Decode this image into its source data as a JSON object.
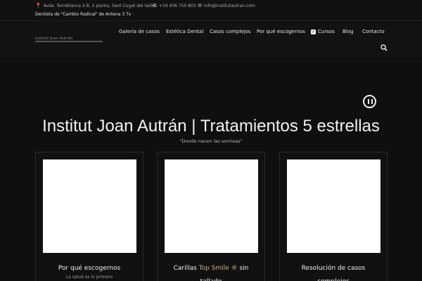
{
  "topbar": {
    "address": "Avda. Torreblanca 2-8, 2 planta, Sant Cugat del Valles",
    "phone": "+34 936 750 803",
    "email": "info@institutautran.com",
    "tagline": "Dentista de \"Cambio Radical\" de Antena 3 Tv",
    "icons": {
      "address": "map-pin-icon",
      "phone": "phone-icon",
      "email": "envelope-icon"
    }
  },
  "header": {
    "logo_text": "Institut Joan Autrán",
    "nav": [
      {
        "label": "Galería de casos"
      },
      {
        "label": "Estética Dental"
      },
      {
        "label": "Casos complejos"
      },
      {
        "label": "Por qué escogernos"
      },
      {
        "label": "Cursos",
        "icon": "checkbox-icon"
      },
      {
        "label": "Blog"
      },
      {
        "label": "Contacto"
      }
    ],
    "search_icon": "search-icon"
  },
  "hero": {
    "title": "Institut Joan Autrán | Tratamientos 5 estrellas",
    "subtitle": "\"Donde nacen las sonrisas\"",
    "pause_icon": "pause-icon"
  },
  "cards": [
    {
      "title": "Por qué escogernos",
      "description": "La salud es lo primero"
    },
    {
      "title_pre": "Carillas ",
      "title_highlight": "Top Smile ®",
      "title_post": " sin tallado"
    },
    {
      "title": "Resolución de casos complejos"
    }
  ],
  "colors": {
    "background": "#0f0f0f",
    "accent_gold": "#c9b27a",
    "text": "#f0f0f0"
  }
}
